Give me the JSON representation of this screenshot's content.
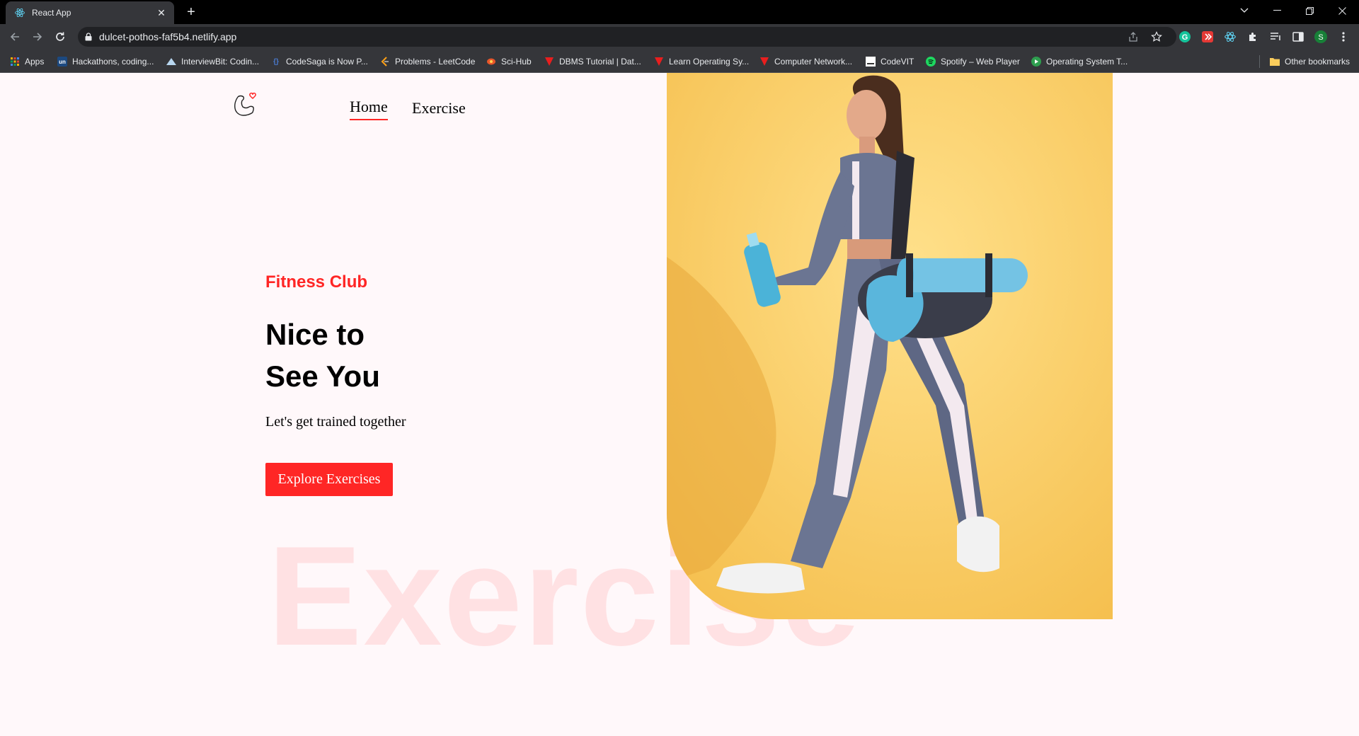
{
  "browser": {
    "tab_title": "React App",
    "url": "dulcet-pothos-faf5b4.netlify.app",
    "bookmarks": [
      {
        "label": "Apps",
        "icon": "apps-grid-icon"
      },
      {
        "label": "Hackathons, coding...",
        "icon": "unstop-icon"
      },
      {
        "label": "InterviewBit: Codin...",
        "icon": "interviewbit-icon"
      },
      {
        "label": "CodeSaga is Now P...",
        "icon": "codesaga-icon"
      },
      {
        "label": "Problems - LeetCode",
        "icon": "leetcode-icon"
      },
      {
        "label": "Sci-Hub",
        "icon": "scihub-icon"
      },
      {
        "label": "DBMS Tutorial | Dat...",
        "icon": "tutorial-icon"
      },
      {
        "label": "Learn Operating Sy...",
        "icon": "tutorial-icon"
      },
      {
        "label": "Computer Network...",
        "icon": "tutorial-icon"
      },
      {
        "label": "CodeVIT",
        "icon": "codevit-icon"
      },
      {
        "label": "Spotify – Web Player",
        "icon": "spotify-icon"
      },
      {
        "label": "Operating System T...",
        "icon": "os-icon"
      }
    ],
    "other_bookmarks": "Other bookmarks",
    "profile_initial": "S"
  },
  "nav": {
    "home": "Home",
    "exercise": "Exercise"
  },
  "hero": {
    "kicker": "Fitness Club",
    "title_line1": "Nice to",
    "title_line2": "See You",
    "subtitle": "Let's get trained together",
    "button": "Explore Exercises",
    "watermark": "Exercise"
  },
  "colors": {
    "accent": "#ff2625",
    "page_bg": "#fff8fa",
    "hero_image_bg": "#f7c95a"
  }
}
